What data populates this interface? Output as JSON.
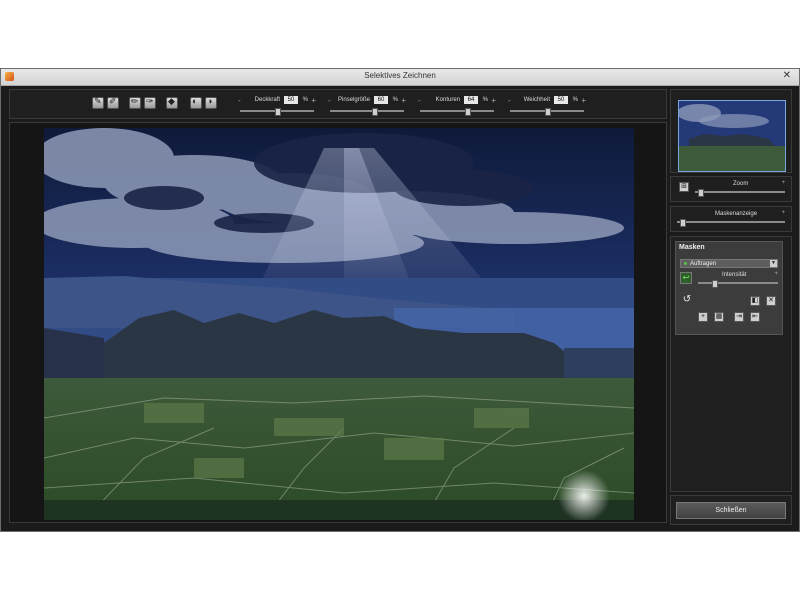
{
  "window": {
    "title": "Selektives Zeichnen",
    "close_glyph": "✕"
  },
  "toolbar": {
    "tools": [
      {
        "icon": "brush-icon"
      },
      {
        "icon": "eraser-brush-icon"
      },
      {
        "icon": "pen-icon"
      },
      {
        "icon": "eraser-pen-icon"
      },
      {
        "icon": "fill-icon"
      },
      {
        "icon": "gradient-add-icon"
      },
      {
        "icon": "gradient-remove-icon"
      }
    ],
    "params": [
      {
        "label": "Deckkraft",
        "value": "50",
        "unit": "%",
        "minus": "-",
        "plus": "+",
        "level": 0.5
      },
      {
        "label": "Pinselgröße",
        "value": "60",
        "unit": "%",
        "minus": "-",
        "plus": "+",
        "level": 0.6
      },
      {
        "label": "Konturen",
        "value": "64",
        "unit": "%",
        "minus": "-",
        "plus": "+",
        "level": 0.64
      },
      {
        "label": "Weichheit",
        "value": "50",
        "unit": "%",
        "minus": "-",
        "plus": "+",
        "level": 0.5
      }
    ]
  },
  "navigator": {
    "zoom_label": "Zoom",
    "zoom_plus": "+",
    "zoom_level": 0.05
  },
  "mask_display": {
    "label": "Maskenanzeige",
    "plus": "+",
    "level": 0.05
  },
  "masks": {
    "title": "Masken",
    "mode_option": "Auftragen",
    "intensity_label": "Intensität",
    "intensity_plus": "+",
    "intensity_level": 0.2
  },
  "footer": {
    "close_label": "Schließen"
  },
  "colors": {
    "accent": "#7aa6e0",
    "window_bg": "#1b1b1b",
    "panel_bg": "#1f1f1f",
    "mask_bg": "#3c3c3c"
  }
}
